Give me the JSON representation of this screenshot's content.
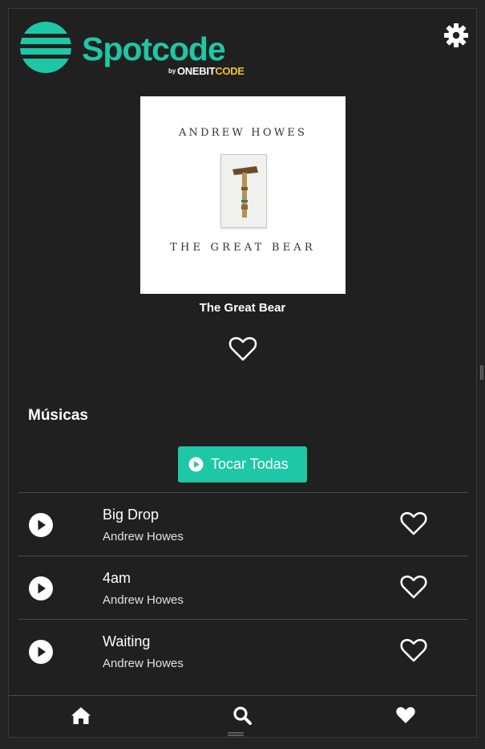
{
  "header": {
    "logo_word": "Spotcode",
    "logo_by": "by",
    "logo_one_bit": "ONEBIT",
    "logo_code": "CODE"
  },
  "icons": {
    "settings": "gear-icon",
    "favorite": "heart-outline-icon",
    "play": "play-circle-icon",
    "home": "home-icon",
    "search": "search-icon",
    "favorites_nav": "heart-solid-icon"
  },
  "colors": {
    "accent": "#1ec7a5",
    "background": "#202020",
    "logo_code": "#f3c02b"
  },
  "album": {
    "cover_artist": "ANDREW HOWES",
    "cover_title": "THE GREAT BEAR",
    "title": "The Great Bear"
  },
  "tracks_section": {
    "title": "Músicas",
    "play_all_label": "Tocar Todas",
    "items": [
      {
        "name": "Big Drop",
        "artist": "Andrew Howes"
      },
      {
        "name": "4am",
        "artist": "Andrew Howes"
      },
      {
        "name": "Waiting",
        "artist": "Andrew Howes"
      }
    ]
  }
}
